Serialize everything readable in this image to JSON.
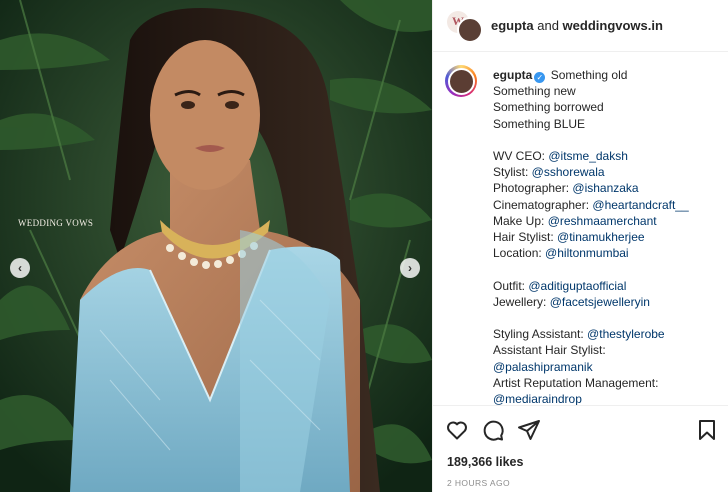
{
  "photo": {
    "watermark": "WEDDING VOWS",
    "prev_icon": "chevron-left-icon",
    "next_icon": "chevron-right-icon"
  },
  "header": {
    "user": "egupta",
    "joiner": " and ",
    "collab": "weddingvows.in",
    "collab_logo_letter": "W"
  },
  "caption": {
    "username": "egupta",
    "verified_icon": "verified-badge-icon",
    "lines": [
      {
        "text": "Something old",
        "blank": false
      },
      {
        "text": "Something new",
        "blank": false
      },
      {
        "text": "Something borrowed",
        "blank": false
      },
      {
        "text": "Something BLUE",
        "blank": false
      },
      {
        "text": "",
        "blank": true
      },
      {
        "label": "WV CEO: ",
        "mention": "@itsme_daksh"
      },
      {
        "label": "Stylist: ",
        "mention": "@sshorewala"
      },
      {
        "label": "Photographer: ",
        "mention": "@ishanzaka"
      },
      {
        "label": "Cinematographer: ",
        "mention": "@heartandcraft__"
      },
      {
        "label": "Make Up: ",
        "mention": "@reshmaamerchant"
      },
      {
        "label": "Hair Stylist: ",
        "mention": "@tinamukherjee"
      },
      {
        "label": "Location: ",
        "mention": "@hiltonmumbai"
      },
      {
        "text": "",
        "blank": true
      },
      {
        "label": "Outfit: ",
        "mention": "@aditiguptaofficial"
      },
      {
        "label": "Jewellery: ",
        "mention": "@facetsjewelleryin"
      },
      {
        "text": "",
        "blank": true
      },
      {
        "label": "Styling Assistant: ",
        "mention": "@thestylerobe"
      },
      {
        "text": "Assistant Hair Stylist:",
        "blank": false
      },
      {
        "label": "",
        "mention": "@palashipramanik"
      },
      {
        "text": "Artist Reputation Management:",
        "blank": false
      },
      {
        "label": "",
        "mention": "@mediaraindrop"
      }
    ]
  },
  "actions": {
    "like_icon": "heart-icon",
    "comment_icon": "comment-icon",
    "share_icon": "share-icon",
    "save_icon": "bookmark-icon"
  },
  "likes": "189,366 likes",
  "timestamp": "2 HOURS AGO",
  "colors": {
    "mention": "#00376b",
    "verified": "#3897f0",
    "muted": "#8e8e8e",
    "saree": "#8fc6dc",
    "foliage": "#1d3a22"
  }
}
